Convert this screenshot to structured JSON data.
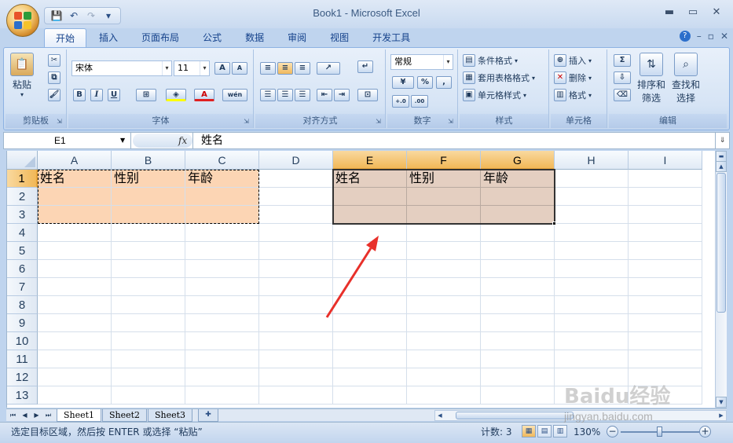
{
  "window": {
    "title": "Book1 - Microsoft Excel",
    "min": "▬",
    "max": "▭",
    "close": "✕"
  },
  "qat": {
    "save": "💾",
    "undo": "↶",
    "redo": "↷",
    "customize": "▾"
  },
  "ribbon": {
    "tabs": [
      "开始",
      "插入",
      "页面布局",
      "公式",
      "数据",
      "审阅",
      "视图",
      "开发工具"
    ],
    "right_controls": {
      "help": "?",
      "min": "–",
      "restore": "▫",
      "close": "✕"
    },
    "clipboard": {
      "label": "剪贴板",
      "paste": "粘贴"
    },
    "font": {
      "label": "字体",
      "family": "宋体",
      "size": "11",
      "bold": "B",
      "italic": "I",
      "underline": "U",
      "grow": "A",
      "shrink": "A",
      "wen": "wén"
    },
    "alignment": {
      "label": "对齐方式"
    },
    "number": {
      "label": "数字",
      "format": "常规",
      "percent": "%",
      "comma": ",",
      "inc": "+.0",
      "dec": ".00"
    },
    "styles": {
      "label": "样式",
      "conditional": "条件格式",
      "table": "套用表格格式",
      "cell": "单元格样式"
    },
    "cells": {
      "label": "单元格",
      "insert": "插入",
      "delete": "删除",
      "format": "格式"
    },
    "editing": {
      "label": "编辑",
      "sort": [
        "排序和",
        "筛选"
      ],
      "find": [
        "查找和",
        "选择"
      ],
      "sigma": "Σ"
    }
  },
  "formula_bar": {
    "name_box": "E1",
    "fx": "fx",
    "content": "姓名"
  },
  "grid": {
    "columns": [
      "A",
      "B",
      "C",
      "D",
      "E",
      "F",
      "G",
      "H",
      "I"
    ],
    "rows": [
      "1",
      "2",
      "3",
      "4",
      "5",
      "6",
      "7",
      "8",
      "9",
      "10",
      "11",
      "12",
      "13"
    ],
    "source_headers": [
      "姓名",
      "性别",
      "年龄"
    ],
    "pasted_headers": [
      "姓名",
      "性别",
      "年龄"
    ]
  },
  "sheet_tabs": [
    "Sheet1",
    "Sheet2",
    "Sheet3"
  ],
  "status": {
    "message": "选定目标区域，然后按 ENTER 或选择 “粘贴”",
    "count": "计数: 3",
    "zoom": "130%"
  },
  "watermark": {
    "text": "Baidu经验",
    "url": "jingyan.baidu.com"
  },
  "colors": {
    "source_fill": "#fcd5b4",
    "paste_fill": "#e4cfc1",
    "arrow": "#e8302a",
    "selected_header": "#f1b858"
  }
}
